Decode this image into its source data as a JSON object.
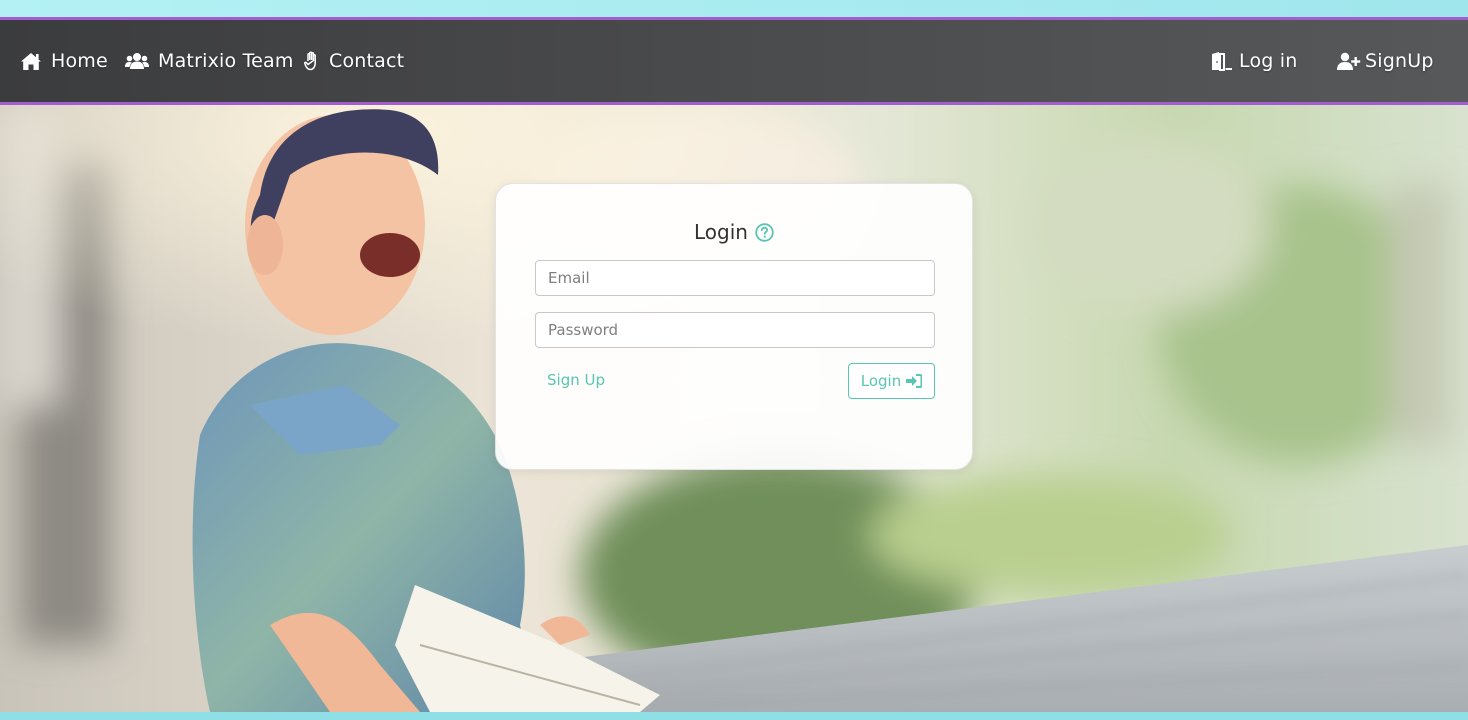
{
  "nav": {
    "home_label": "Home",
    "team_label": "Matrixio Team",
    "contact_label": "Contact",
    "login_label": "Log in",
    "signup_label": "SignUp"
  },
  "login_card": {
    "title": "Login",
    "email_placeholder": "Email",
    "password_placeholder": "Password",
    "signup_link": "Sign Up",
    "login_button": "Login"
  },
  "colors": {
    "accent_teal": "#58c6b2",
    "navbar_border": "#a25ed0",
    "top_strip": "#b3f1f4"
  },
  "icons": {
    "home": "home-icon",
    "team": "users-icon",
    "contact": "hand-icon",
    "login": "door-icon",
    "signup": "user-plus-icon",
    "help": "question-circle-icon",
    "login_button": "sign-in-icon"
  }
}
